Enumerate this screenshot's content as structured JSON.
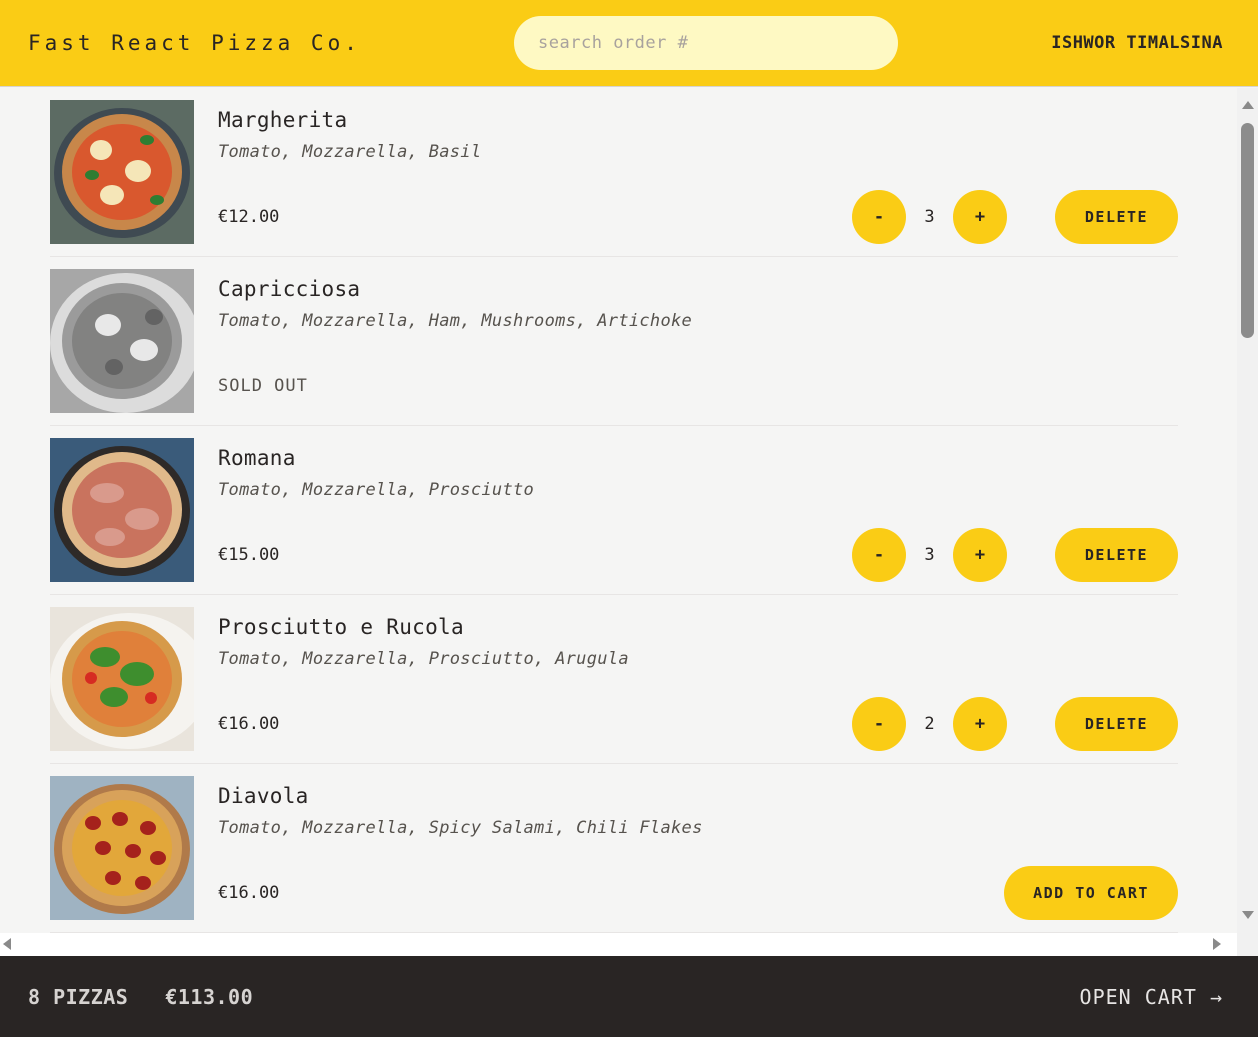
{
  "header": {
    "logo": "Fast React Pizza Co.",
    "search_placeholder": "search order #",
    "username": "ISHWOR TIMALSINA"
  },
  "menu": [
    {
      "name": "Margherita",
      "ingredients": "Tomato, Mozzarella, Basil",
      "price": "€12.00",
      "sold_out": false,
      "in_cart": true,
      "quantity": "3",
      "decrease_label": "-",
      "increase_label": "+",
      "delete_label": "Delete",
      "image_icon": "pizza-image"
    },
    {
      "name": "Capricciosa",
      "ingredients": "Tomato, Mozzarella, Ham, Mushrooms, Artichoke",
      "sold_out": true,
      "sold_out_label": "Sold out",
      "image_icon": "pizza-image"
    },
    {
      "name": "Romana",
      "ingredients": "Tomato, Mozzarella, Prosciutto",
      "price": "€15.00",
      "sold_out": false,
      "in_cart": true,
      "quantity": "3",
      "decrease_label": "-",
      "increase_label": "+",
      "delete_label": "Delete",
      "image_icon": "pizza-image"
    },
    {
      "name": "Prosciutto e Rucola",
      "ingredients": "Tomato, Mozzarella, Prosciutto, Arugula",
      "price": "€16.00",
      "sold_out": false,
      "in_cart": true,
      "quantity": "2",
      "decrease_label": "-",
      "increase_label": "+",
      "delete_label": "Delete",
      "image_icon": "pizza-image"
    },
    {
      "name": "Diavola",
      "ingredients": "Tomato, Mozzarella, Spicy Salami, Chili Flakes",
      "price": "€16.00",
      "sold_out": false,
      "in_cart": false,
      "add_label": "Add to cart",
      "image_icon": "pizza-image"
    }
  ],
  "cart": {
    "count": "8 pizzas",
    "total": "€113.00",
    "open_label": "Open cart →"
  },
  "colors": {
    "accent": "#facc15",
    "header_bg": "#facc15",
    "search_bg": "#fef9c3",
    "page_bg": "#f5f5f4",
    "cart_bar_bg": "#292524",
    "text": "#292524"
  }
}
